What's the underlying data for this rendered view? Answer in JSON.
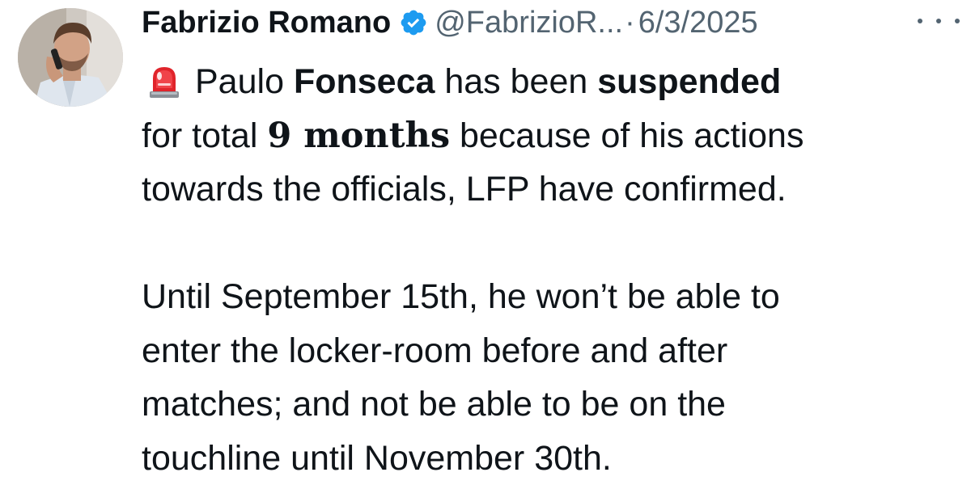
{
  "author": {
    "display_name": "Fabrizio Romano",
    "handle": "@FabrizioR...",
    "separator": "·",
    "date": "6/3/2025",
    "verified_icon": "verified-badge-icon",
    "avatar_icon": "avatar-photo"
  },
  "colors": {
    "verified_blue": "#1d9bf0",
    "secondary_text": "#536471",
    "primary_text": "#0f1419",
    "siren_red": "#e0242b"
  },
  "tweet": {
    "emoji": "siren-emoji-icon",
    "line1": {
      "pre": "Paulo ",
      "bold1": "Fonseca",
      "mid": " has been ",
      "bold2": "suspended"
    },
    "line2": {
      "pre": "for total ",
      "bold": "9 months",
      "post": " because of his actions"
    },
    "line3": "towards the officials, LFP have confirmed.",
    "line4": "Until September 15th, he won’t be able to",
    "line5": "enter the locker-room before and after",
    "line6": "matches; and not be able to be on the",
    "line7": "touchline until November 30th."
  }
}
